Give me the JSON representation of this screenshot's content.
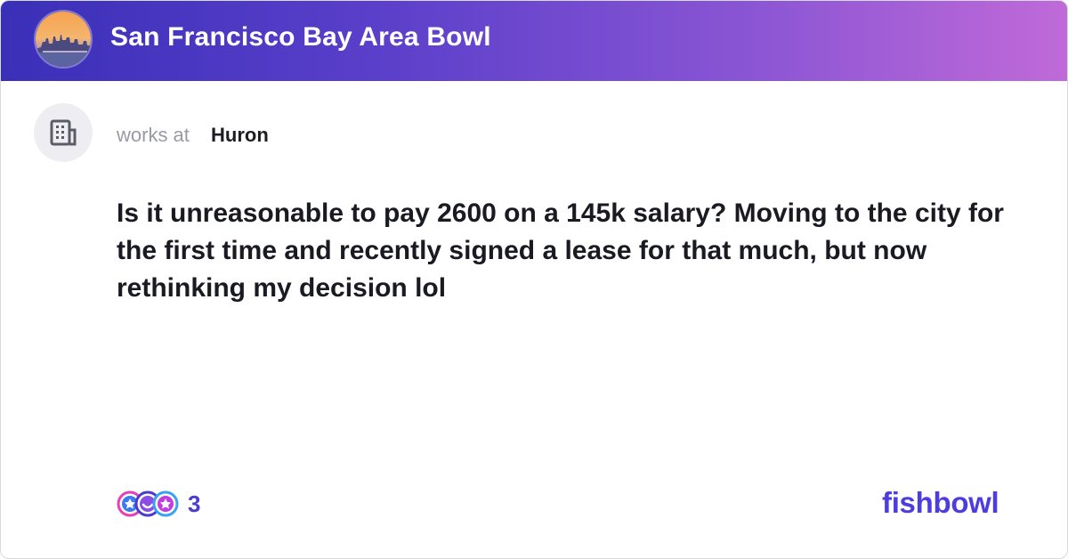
{
  "header": {
    "bowl_title": "San Francisco Bay Area Bowl",
    "avatar_icon": "city-skyline-photo",
    "gradient_start": "#3a2fb8",
    "gradient_end": "#c06ad8"
  },
  "author": {
    "avatar_icon": "building-icon",
    "works_at_label": "works at",
    "company": "Huron"
  },
  "post": {
    "text": "Is it unreasonable to pay 2600 on a 145k salary? Moving to the city for the first time and recently signed a lease for that much, but now rethinking my decision lol"
  },
  "reactions": {
    "icons": [
      "like-reaction-icon",
      "smile-reaction-icon",
      "star-reaction-icon"
    ],
    "count": "3"
  },
  "brand": {
    "name": "fishbowl",
    "color": "#4d3de0"
  }
}
